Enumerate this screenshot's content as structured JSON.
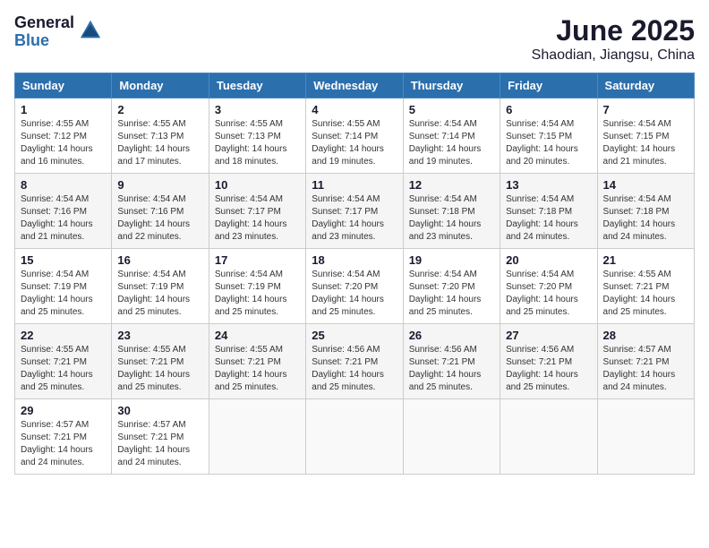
{
  "logo": {
    "general": "General",
    "blue": "Blue"
  },
  "title": {
    "month": "June 2025",
    "location": "Shaodian, Jiangsu, China"
  },
  "days_of_week": [
    "Sunday",
    "Monday",
    "Tuesday",
    "Wednesday",
    "Thursday",
    "Friday",
    "Saturday"
  ],
  "weeks": [
    [
      {
        "day": "1",
        "sunrise": "Sunrise: 4:55 AM",
        "sunset": "Sunset: 7:12 PM",
        "daylight": "Daylight: 14 hours and 16 minutes."
      },
      {
        "day": "2",
        "sunrise": "Sunrise: 4:55 AM",
        "sunset": "Sunset: 7:13 PM",
        "daylight": "Daylight: 14 hours and 17 minutes."
      },
      {
        "day": "3",
        "sunrise": "Sunrise: 4:55 AM",
        "sunset": "Sunset: 7:13 PM",
        "daylight": "Daylight: 14 hours and 18 minutes."
      },
      {
        "day": "4",
        "sunrise": "Sunrise: 4:55 AM",
        "sunset": "Sunset: 7:14 PM",
        "daylight": "Daylight: 14 hours and 19 minutes."
      },
      {
        "day": "5",
        "sunrise": "Sunrise: 4:54 AM",
        "sunset": "Sunset: 7:14 PM",
        "daylight": "Daylight: 14 hours and 19 minutes."
      },
      {
        "day": "6",
        "sunrise": "Sunrise: 4:54 AM",
        "sunset": "Sunset: 7:15 PM",
        "daylight": "Daylight: 14 hours and 20 minutes."
      },
      {
        "day": "7",
        "sunrise": "Sunrise: 4:54 AM",
        "sunset": "Sunset: 7:15 PM",
        "daylight": "Daylight: 14 hours and 21 minutes."
      }
    ],
    [
      {
        "day": "8",
        "sunrise": "Sunrise: 4:54 AM",
        "sunset": "Sunset: 7:16 PM",
        "daylight": "Daylight: 14 hours and 21 minutes."
      },
      {
        "day": "9",
        "sunrise": "Sunrise: 4:54 AM",
        "sunset": "Sunset: 7:16 PM",
        "daylight": "Daylight: 14 hours and 22 minutes."
      },
      {
        "day": "10",
        "sunrise": "Sunrise: 4:54 AM",
        "sunset": "Sunset: 7:17 PM",
        "daylight": "Daylight: 14 hours and 23 minutes."
      },
      {
        "day": "11",
        "sunrise": "Sunrise: 4:54 AM",
        "sunset": "Sunset: 7:17 PM",
        "daylight": "Daylight: 14 hours and 23 minutes."
      },
      {
        "day": "12",
        "sunrise": "Sunrise: 4:54 AM",
        "sunset": "Sunset: 7:18 PM",
        "daylight": "Daylight: 14 hours and 23 minutes."
      },
      {
        "day": "13",
        "sunrise": "Sunrise: 4:54 AM",
        "sunset": "Sunset: 7:18 PM",
        "daylight": "Daylight: 14 hours and 24 minutes."
      },
      {
        "day": "14",
        "sunrise": "Sunrise: 4:54 AM",
        "sunset": "Sunset: 7:18 PM",
        "daylight": "Daylight: 14 hours and 24 minutes."
      }
    ],
    [
      {
        "day": "15",
        "sunrise": "Sunrise: 4:54 AM",
        "sunset": "Sunset: 7:19 PM",
        "daylight": "Daylight: 14 hours and 25 minutes."
      },
      {
        "day": "16",
        "sunrise": "Sunrise: 4:54 AM",
        "sunset": "Sunset: 7:19 PM",
        "daylight": "Daylight: 14 hours and 25 minutes."
      },
      {
        "day": "17",
        "sunrise": "Sunrise: 4:54 AM",
        "sunset": "Sunset: 7:19 PM",
        "daylight": "Daylight: 14 hours and 25 minutes."
      },
      {
        "day": "18",
        "sunrise": "Sunrise: 4:54 AM",
        "sunset": "Sunset: 7:20 PM",
        "daylight": "Daylight: 14 hours and 25 minutes."
      },
      {
        "day": "19",
        "sunrise": "Sunrise: 4:54 AM",
        "sunset": "Sunset: 7:20 PM",
        "daylight": "Daylight: 14 hours and 25 minutes."
      },
      {
        "day": "20",
        "sunrise": "Sunrise: 4:54 AM",
        "sunset": "Sunset: 7:20 PM",
        "daylight": "Daylight: 14 hours and 25 minutes."
      },
      {
        "day": "21",
        "sunrise": "Sunrise: 4:55 AM",
        "sunset": "Sunset: 7:21 PM",
        "daylight": "Daylight: 14 hours and 25 minutes."
      }
    ],
    [
      {
        "day": "22",
        "sunrise": "Sunrise: 4:55 AM",
        "sunset": "Sunset: 7:21 PM",
        "daylight": "Daylight: 14 hours and 25 minutes."
      },
      {
        "day": "23",
        "sunrise": "Sunrise: 4:55 AM",
        "sunset": "Sunset: 7:21 PM",
        "daylight": "Daylight: 14 hours and 25 minutes."
      },
      {
        "day": "24",
        "sunrise": "Sunrise: 4:55 AM",
        "sunset": "Sunset: 7:21 PM",
        "daylight": "Daylight: 14 hours and 25 minutes."
      },
      {
        "day": "25",
        "sunrise": "Sunrise: 4:56 AM",
        "sunset": "Sunset: 7:21 PM",
        "daylight": "Daylight: 14 hours and 25 minutes."
      },
      {
        "day": "26",
        "sunrise": "Sunrise: 4:56 AM",
        "sunset": "Sunset: 7:21 PM",
        "daylight": "Daylight: 14 hours and 25 minutes."
      },
      {
        "day": "27",
        "sunrise": "Sunrise: 4:56 AM",
        "sunset": "Sunset: 7:21 PM",
        "daylight": "Daylight: 14 hours and 25 minutes."
      },
      {
        "day": "28",
        "sunrise": "Sunrise: 4:57 AM",
        "sunset": "Sunset: 7:21 PM",
        "daylight": "Daylight: 14 hours and 24 minutes."
      }
    ],
    [
      {
        "day": "29",
        "sunrise": "Sunrise: 4:57 AM",
        "sunset": "Sunset: 7:21 PM",
        "daylight": "Daylight: 14 hours and 24 minutes."
      },
      {
        "day": "30",
        "sunrise": "Sunrise: 4:57 AM",
        "sunset": "Sunset: 7:21 PM",
        "daylight": "Daylight: 14 hours and 24 minutes."
      },
      null,
      null,
      null,
      null,
      null
    ]
  ]
}
